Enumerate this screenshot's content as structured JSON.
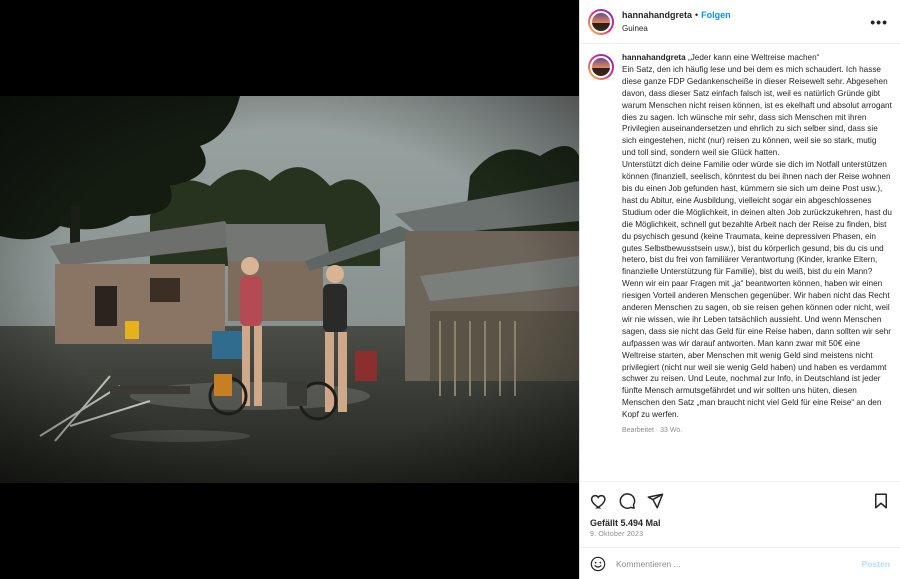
{
  "post": {
    "username": "hannahandgreta",
    "separator": "•",
    "follow_label": "Folgen",
    "location": "Guinea",
    "more_icon": "more-horizontal-icon",
    "photo_alt": "Two women standing with loaded bicycles in a muddy village street"
  },
  "caption": {
    "username": "hannahandgreta",
    "lines": [
      "„Jeder kann eine Weltreise machen“",
      "Ein Satz, den ich häufig lese und bei dem es mich schaudert. Ich hasse diese ganze FDP Gedankenscheiße in dieser Reisewelt sehr. Abgesehen davon, dass dieser Satz einfach falsch ist, weil es natürlich Gründe gibt warum Menschen nicht reisen können, ist es ekelhaft und absolut arrogant dies zu sagen. Ich wünsche mir sehr, dass sich Menschen mit ihren Privilegien auseinandersetzen und ehrlich zu sich selber sind, dass sie sich eingestehen, nicht (nur) reisen zu können, weil sie so stark, mutig und toll sind, sondern weil sie Glück hatten.",
      "Unterstützt dich deine Familie oder würde sie dich im Notfall unterstützen können (finanziell, seelisch, könntest du bei ihnen nach der Reise wohnen bis du einen Job gefunden hast, kümmern sie sich um deine Post usw.), hast du Abitur, eine Ausbildung, vielleicht sogar ein abgeschlossenes Studium oder die Möglichkeit, in deinen alten Job zurückzukehren, hast du die Möglichkeit, schnell gut bezahlte Arbeit nach der Reise zu finden, bist du psychisch gesund (keine Traumata, keine depressiven Phasen, ein gutes Selbstbewusstsein usw.), bist du körperlich gesund, bis du cis und hetero, bist du frei von familiärer Verantwortung (Kinder, kranke Eltern, finanzielle Unterstützung für Familie), bist du weiß, bist du ein Mann?",
      "Wenn wir ein paar Fragen mit „ja“ beantworten können, haben wir einen riesigen Vorteil anderen Menschen gegenüber. Wir haben nicht das Recht anderen Menschen zu sagen, ob sie reisen gehen können oder nicht, weil wir nie wissen, wie ihr Leben tatsächlich aussieht. Und wenn Menschen sagen, dass sie nicht das Geld für eine Reise haben, dann sollten wir sehr aufpassen was wir darauf antworten. Man kann zwar mit 50€ eine Weltreise starten, aber Menschen mit wenig Geld sind meistens nicht privilegiert (nicht nur weil sie wenig Geld haben) und haben es verdammt schwer zu reisen. Und Leute, nochmal zur Info, in Deutschland ist jeder fünfte Mensch armutsgefährdet und wir sollten uns hüten, diesen Menschen den Satz „man braucht nicht viel Geld für eine Reise“ an den Kopf zu werfen."
    ],
    "edited": "Bearbeitet · 33 Wo."
  },
  "actions": {
    "like_icon": "heart-icon",
    "comment_icon": "comment-icon",
    "share_icon": "share-icon",
    "save_icon": "bookmark-icon",
    "likes": "Gefällt 5.494 Mal",
    "date": "9. Oktober 2023"
  },
  "comment_box": {
    "emoji_icon": "emoji-icon",
    "placeholder": "Kommentieren ...",
    "post_label": "Posten"
  },
  "colors": {
    "follow": "#0095f6",
    "muted": "#8e8e8e",
    "post_disabled": "#b2dffc"
  }
}
